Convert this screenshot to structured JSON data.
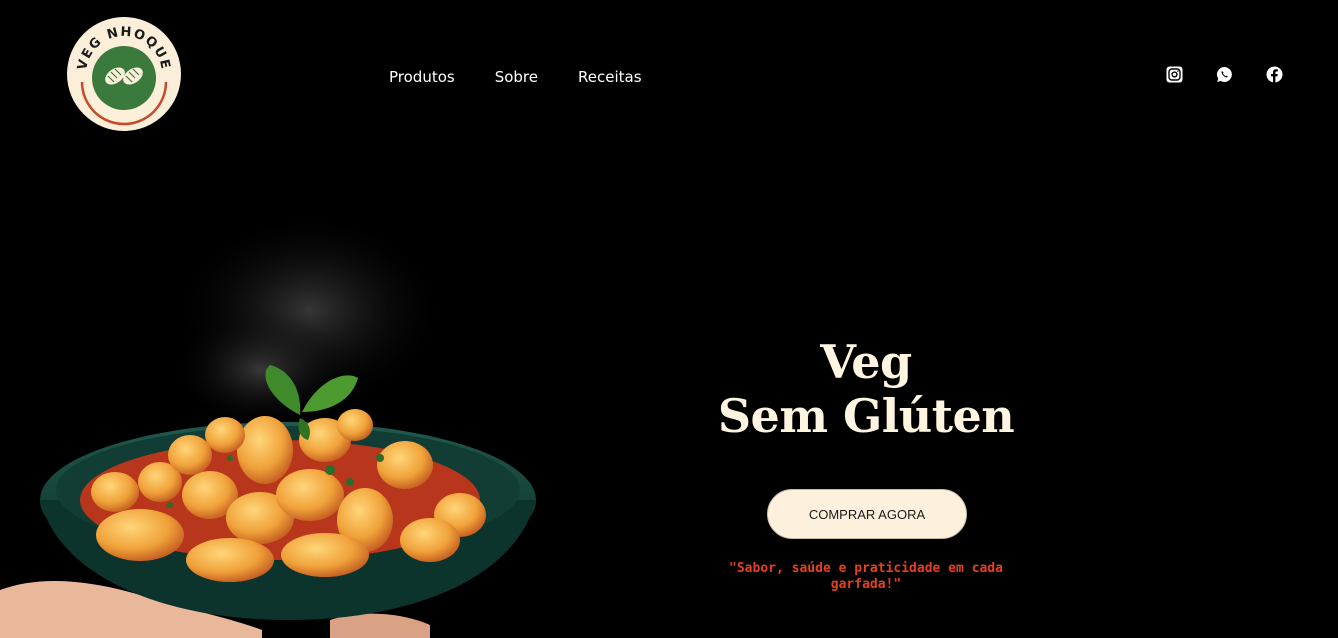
{
  "brand": {
    "logo_text": "VEG NHOQUE"
  },
  "nav": {
    "items": [
      {
        "label": "Produtos"
      },
      {
        "label": "Sobre"
      },
      {
        "label": "Receitas"
      }
    ]
  },
  "social": {
    "icons": [
      "instagram-icon",
      "whatsapp-icon",
      "facebook-icon"
    ]
  },
  "hero": {
    "title_line1": "Veg",
    "title_line2": "Sem Glúten",
    "cta_label": "COMPRAR AGORA",
    "tagline": "\"Sabor, saúde e praticidade em cada garfada!\""
  },
  "colors": {
    "background": "#000000",
    "logo_cream": "#fbefd9",
    "logo_green": "#3a7a3c",
    "logo_ring": "#c7492c",
    "title": "#fff5e0",
    "cta_bg": "#fdf0dc",
    "tagline": "#e5401f"
  }
}
